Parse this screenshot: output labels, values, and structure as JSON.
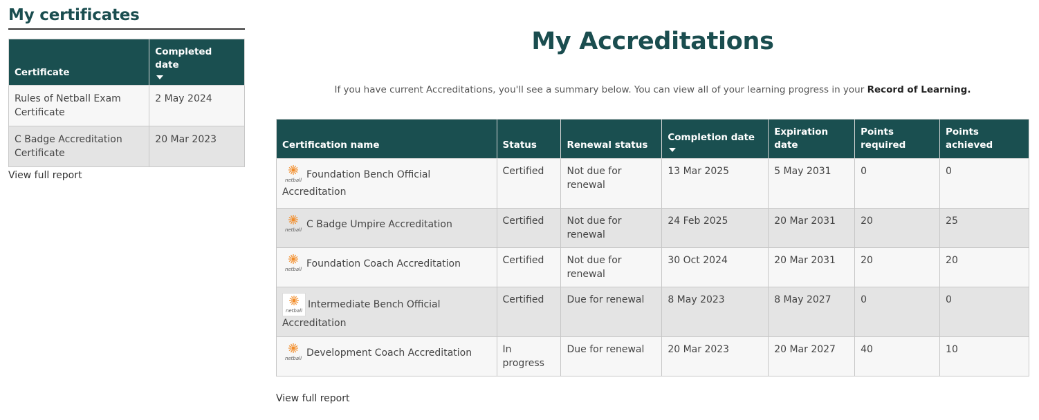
{
  "certificates": {
    "title": "My certificates",
    "headers": {
      "certificate": "Certificate",
      "completed": "Completed date"
    },
    "rows": [
      {
        "name": "Rules of Netball Exam Certificate",
        "date": "2 May 2024"
      },
      {
        "name": "C Badge Accreditation Certificate",
        "date": "20 Mar 2023"
      }
    ],
    "report_link": "View full report"
  },
  "accreditations": {
    "title": "My Accreditations",
    "intro_prefix": "If you have current Accreditations, you'll see a summary below. You can view all of your learning progress in your ",
    "intro_link": "Record of Learning.",
    "headers": {
      "name": "Certification name",
      "status": "Status",
      "renewal": "Renewal status",
      "completion": "Completion date",
      "expiration": "Expiration date",
      "points_required": "Points required",
      "points_achieved": "Points achieved"
    },
    "rows": [
      {
        "name": "Foundation Bench Official Accreditation",
        "status": "Certified",
        "renewal": "Not due for renewal",
        "completion": "13 Mar 2025",
        "expiration": "5 May 2031",
        "points_required": "0",
        "points_achieved": "0"
      },
      {
        "name": "C Badge Umpire Accreditation",
        "status": "Certified",
        "renewal": "Not due for renewal",
        "completion": "24 Feb 2025",
        "expiration": "20 Mar 2031",
        "points_required": "20",
        "points_achieved": "25"
      },
      {
        "name": "Foundation Coach Accreditation",
        "status": "Certified",
        "renewal": "Not due for renewal",
        "completion": "30 Oct 2024",
        "expiration": "20 Mar 2031",
        "points_required": "20",
        "points_achieved": "20"
      },
      {
        "name": "Intermediate Bench Official Accreditation",
        "status": "Certified",
        "renewal": "Due for renewal",
        "completion": "8 May 2023",
        "expiration": "8 May 2027",
        "points_required": "0",
        "points_achieved": "0"
      },
      {
        "name": "Development Coach Accreditation",
        "status": "In progress",
        "renewal": "Due for renewal",
        "completion": "20 Mar 2023",
        "expiration": "20 Mar 2027",
        "points_required": "40",
        "points_achieved": "10"
      }
    ],
    "report_link": "View full report",
    "logo_text": "netball"
  },
  "colors": {
    "brand": "#1a4f50",
    "row_light": "#f7f7f7",
    "row_dark": "#e4e4e4",
    "logo_orange": "#f28c28"
  }
}
